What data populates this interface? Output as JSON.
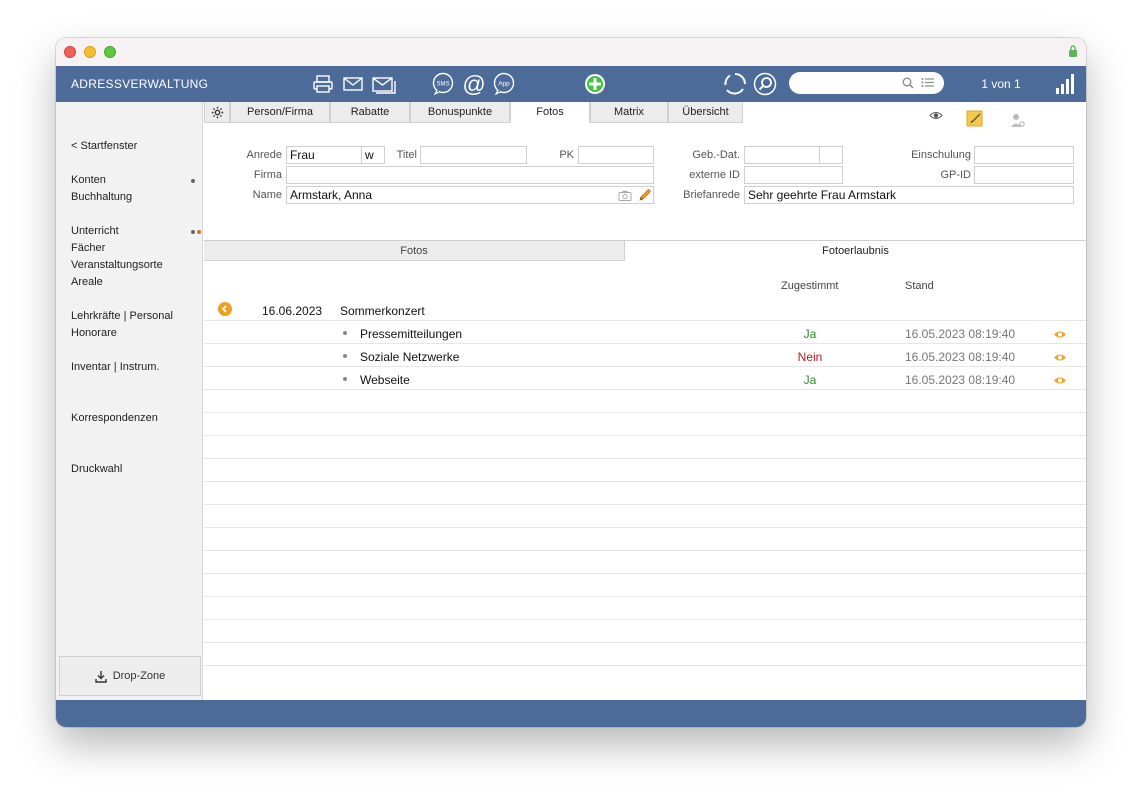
{
  "header": {
    "app_title": "ADRESSVERWALTUNG",
    "counter": "1 von 1",
    "search_value": "",
    "icons": [
      "printer-icon",
      "mail-icon",
      "mail-stack-icon",
      "sms-icon",
      "at-icon",
      "app-icon",
      "add-icon",
      "refresh-icon",
      "search-icon",
      "list-icon",
      "signal-icon"
    ],
    "sms_label": "SMS",
    "at_label": "@",
    "app_label": "App"
  },
  "sidebar": {
    "items": [
      {
        "label": "< Startfenster"
      },
      {
        "label": "Konten"
      },
      {
        "label": "Buchhaltung"
      },
      {
        "label": "Unterricht"
      },
      {
        "label": "Fächer"
      },
      {
        "label": "Veranstaltungsorte"
      },
      {
        "label": "Areale"
      },
      {
        "label": "Lehrkräfte | Personal"
      },
      {
        "label": "Honorare"
      },
      {
        "label": "Inventar | Instrum."
      },
      {
        "label": "Korrespondenzen"
      },
      {
        "label": "Druckwahl"
      }
    ],
    "dropzone_label": "Drop-Zone"
  },
  "tabs": {
    "items": [
      {
        "label": "Person/Firma"
      },
      {
        "label": "Rabatte"
      },
      {
        "label": "Bonuspunkte"
      },
      {
        "label": "Fotos"
      },
      {
        "label": "Matrix"
      },
      {
        "label": "Übersicht"
      }
    ],
    "active": "Fotos"
  },
  "form": {
    "anrede_label": "Anrede",
    "anrede_value": "Frau",
    "gender_value": "w",
    "titel_label": "Titel",
    "titel_value": "",
    "pk_label": "PK",
    "pk_value": "",
    "firma_label": "Firma",
    "firma_value": "",
    "name_label": "Name",
    "name_value": "Armstark, Anna",
    "gebdat_label": "Geb.-Dat.",
    "gebdat_value": "",
    "einschulung_label": "Einschulung",
    "einschulung_value": "",
    "externe_id_label": "externe ID",
    "externe_id_value": "",
    "gpid_label": "GP-ID",
    "gpid_value": "",
    "briefanrede_label": "Briefanrede",
    "briefanrede_value": "Sehr geehrte Frau Armstark"
  },
  "subtabs": {
    "fotos": "Fotos",
    "fotoerlaubnis": "Fotoerlaubnis"
  },
  "table": {
    "col_zugestimmt": "Zugestimmt",
    "col_stand": "Stand",
    "event_date": "16.06.2023",
    "event_title": "Sommerkonzert",
    "rows": [
      {
        "label": "Pressemitteilungen",
        "status": "Ja",
        "date": "16.05.2023 08:19:40"
      },
      {
        "label": "Soziale Netzwerke",
        "status": "Nein",
        "date": "16.05.2023 08:19:40"
      },
      {
        "label": "Webseite",
        "status": "Ja",
        "date": "16.05.2023 08:19:40"
      }
    ]
  },
  "colors": {
    "bar": "#4d6b99",
    "yes": "#2e8b2e",
    "no": "#c01818",
    "accent_orange": "#f0a020"
  }
}
